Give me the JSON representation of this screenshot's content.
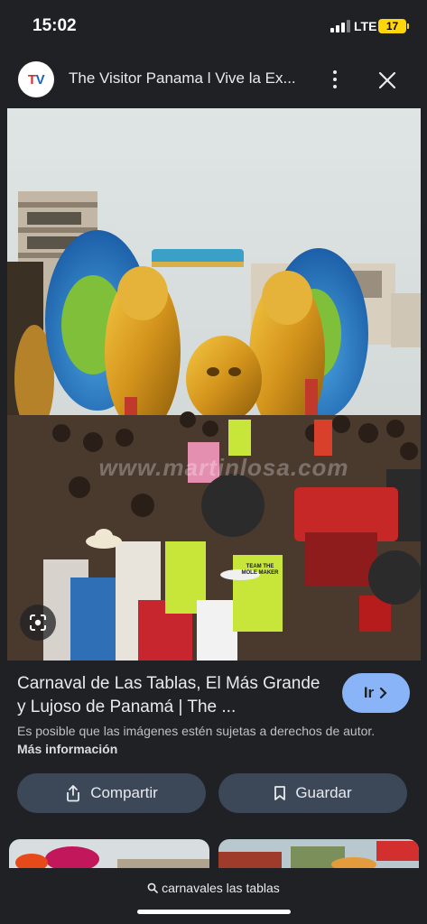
{
  "status_bar": {
    "time": "15:02",
    "network": "LTE",
    "battery": "17"
  },
  "header": {
    "logo_text_t": "T",
    "logo_text_v": "V",
    "title": "The Visitor Panama l Vive la Ex..."
  },
  "image": {
    "watermark": "www.martinlosa.com",
    "tractor_sign": "TEAM THE MOLE MAKER",
    "alt": "carnaval"
  },
  "result": {
    "title": "Carnaval de Las Tablas, El Más Grande y Lujoso de Panamá | The ...",
    "go_label": "Ir",
    "notice": "Es posible que las imágenes estén sujetas a derechos de autor.",
    "more_info": "Más información"
  },
  "actions": {
    "share_label": "Compartir",
    "save_label": "Guardar"
  },
  "search": {
    "query": "carnavales las tablas"
  },
  "colors": {
    "background": "#202124",
    "accent": "#8ab4f8",
    "button": "#3c4758",
    "battery": "#ffd60a"
  }
}
